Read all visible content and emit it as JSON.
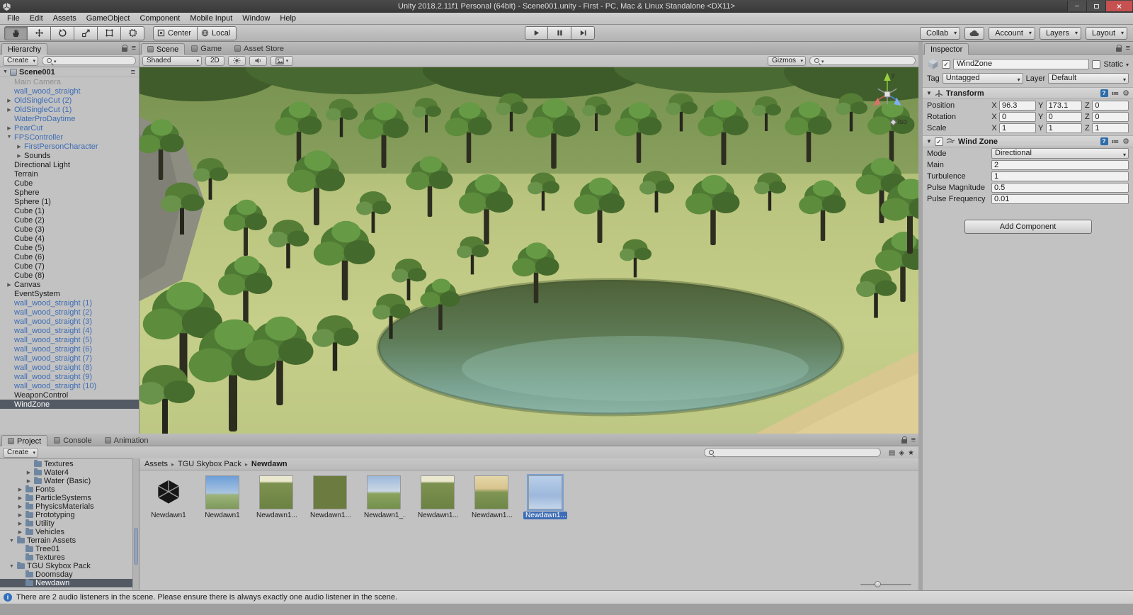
{
  "window": {
    "title": "Unity 2018.2.11f1 Personal (64bit) - Scene001.unity - First - PC, Mac & Linux Standalone <DX11>"
  },
  "menu": {
    "items": [
      "File",
      "Edit",
      "Assets",
      "GameObject",
      "Component",
      "Mobile Input",
      "Window",
      "Help"
    ]
  },
  "toolbar": {
    "pivot_label": "Center",
    "space_label": "Local",
    "collab_label": "Collab",
    "account_label": "Account",
    "layers_label": "Layers",
    "layout_label": "Layout"
  },
  "hierarchy": {
    "tab": "Hierarchy",
    "create_label": "Create",
    "scene": "Scene001",
    "items": [
      {
        "label": "Main Camera",
        "style": "muted",
        "indent": 1,
        "arrow": "none"
      },
      {
        "label": "wall_wood_straight",
        "style": "prefab",
        "indent": 1,
        "arrow": "none"
      },
      {
        "label": "OldSingleCut (2)",
        "style": "prefab",
        "indent": 1,
        "arrow": "right"
      },
      {
        "label": "OldSingleCut (1)",
        "style": "prefab",
        "indent": 1,
        "arrow": "right"
      },
      {
        "label": "WaterProDaytime",
        "style": "prefab",
        "indent": 1,
        "arrow": "none"
      },
      {
        "label": "PearCut",
        "style": "prefab",
        "indent": 1,
        "arrow": "right"
      },
      {
        "label": "FPSController",
        "style": "prefab",
        "indent": 1,
        "arrow": "down"
      },
      {
        "label": "FirstPersonCharacter",
        "style": "prefab",
        "indent": 2,
        "arrow": "right"
      },
      {
        "label": "Sounds",
        "style": "normal",
        "indent": 2,
        "arrow": "right"
      },
      {
        "label": "Directional Light",
        "style": "normal",
        "indent": 1,
        "arrow": "none"
      },
      {
        "label": "Terrain",
        "style": "normal",
        "indent": 1,
        "arrow": "none"
      },
      {
        "label": "Cube",
        "style": "normal",
        "indent": 1,
        "arrow": "none"
      },
      {
        "label": "Sphere",
        "style": "normal",
        "indent": 1,
        "arrow": "none"
      },
      {
        "label": "Sphere (1)",
        "style": "normal",
        "indent": 1,
        "arrow": "none"
      },
      {
        "label": "Cube (1)",
        "style": "normal",
        "indent": 1,
        "arrow": "none"
      },
      {
        "label": "Cube (2)",
        "style": "normal",
        "indent": 1,
        "arrow": "none"
      },
      {
        "label": "Cube (3)",
        "style": "normal",
        "indent": 1,
        "arrow": "none"
      },
      {
        "label": "Cube (4)",
        "style": "normal",
        "indent": 1,
        "arrow": "none"
      },
      {
        "label": "Cube (5)",
        "style": "normal",
        "indent": 1,
        "arrow": "none"
      },
      {
        "label": "Cube (6)",
        "style": "normal",
        "indent": 1,
        "arrow": "none"
      },
      {
        "label": "Cube (7)",
        "style": "normal",
        "indent": 1,
        "arrow": "none"
      },
      {
        "label": "Cube (8)",
        "style": "normal",
        "indent": 1,
        "arrow": "none"
      },
      {
        "label": "Canvas",
        "style": "normal",
        "indent": 1,
        "arrow": "right"
      },
      {
        "label": "EventSystem",
        "style": "normal",
        "indent": 1,
        "arrow": "none"
      },
      {
        "label": "wall_wood_straight (1)",
        "style": "prefab",
        "indent": 1,
        "arrow": "none"
      },
      {
        "label": "wall_wood_straight (2)",
        "style": "prefab",
        "indent": 1,
        "arrow": "none"
      },
      {
        "label": "wall_wood_straight (3)",
        "style": "prefab",
        "indent": 1,
        "arrow": "none"
      },
      {
        "label": "wall_wood_straight (4)",
        "style": "prefab",
        "indent": 1,
        "arrow": "none"
      },
      {
        "label": "wall_wood_straight (5)",
        "style": "prefab",
        "indent": 1,
        "arrow": "none"
      },
      {
        "label": "wall_wood_straight (6)",
        "style": "prefab",
        "indent": 1,
        "arrow": "none"
      },
      {
        "label": "wall_wood_straight (7)",
        "style": "prefab",
        "indent": 1,
        "arrow": "none"
      },
      {
        "label": "wall_wood_straight (8)",
        "style": "prefab",
        "indent": 1,
        "arrow": "none"
      },
      {
        "label": "wall_wood_straight (9)",
        "style": "prefab",
        "indent": 1,
        "arrow": "none"
      },
      {
        "label": "wall_wood_straight (10)",
        "style": "prefab",
        "indent": 1,
        "arrow": "none"
      },
      {
        "label": "WeaponControl",
        "style": "normal",
        "indent": 1,
        "arrow": "none"
      },
      {
        "label": "WindZone",
        "style": "selected",
        "indent": 1,
        "arrow": "none"
      }
    ]
  },
  "scene_view": {
    "tabs": [
      "Scene",
      "Game",
      "Asset Store"
    ],
    "shaded_label": "Shaded",
    "mode_2d_label": "2D",
    "gizmos_label": "Gizmos",
    "projection_label": "Iso",
    "gizmo_axis_label": "y"
  },
  "inspector": {
    "tab": "Inspector",
    "name": "WindZone",
    "static_label": "Static",
    "tag_label": "Tag",
    "tag_value": "Untagged",
    "layer_label": "Layer",
    "layer_value": "Default",
    "transform": {
      "title": "Transform",
      "axis_labels": [
        "X",
        "Y",
        "Z"
      ],
      "rows": [
        {
          "label": "Position",
          "x": "96.3",
          "y": "173.1",
          "z": "0"
        },
        {
          "label": "Rotation",
          "x": "0",
          "y": "0",
          "z": "0"
        },
        {
          "label": "Scale",
          "x": "1",
          "y": "1",
          "z": "1"
        }
      ]
    },
    "wind_zone": {
      "title": "Wind Zone",
      "fields": [
        {
          "label": "Mode",
          "value": "Directional",
          "type": "dropdown"
        },
        {
          "label": "Main",
          "value": "2",
          "type": "field"
        },
        {
          "label": "Turbulence",
          "value": "1",
          "type": "field"
        },
        {
          "label": "Pulse Magnitude",
          "value": "0.5",
          "type": "field"
        },
        {
          "label": "Pulse Frequency",
          "value": "0.01",
          "type": "field"
        }
      ]
    },
    "add_component_label": "Add Component"
  },
  "project": {
    "tabs": [
      "Project",
      "Console",
      "Animation"
    ],
    "create_label": "Create",
    "breadcrumb": [
      "Assets",
      "TGU Skybox Pack",
      "Newdawn"
    ],
    "tree": [
      {
        "label": "Textures",
        "indent": 3,
        "arrow": "none"
      },
      {
        "label": "Water4",
        "indent": 3,
        "arrow": "right"
      },
      {
        "label": "Water (Basic)",
        "indent": 3,
        "arrow": "right"
      },
      {
        "label": "Fonts",
        "indent": 2,
        "arrow": "right"
      },
      {
        "label": "ParticleSystems",
        "indent": 2,
        "arrow": "right"
      },
      {
        "label": "PhysicsMaterials",
        "indent": 2,
        "arrow": "right"
      },
      {
        "label": "Prototyping",
        "indent": 2,
        "arrow": "right"
      },
      {
        "label": "Utility",
        "indent": 2,
        "arrow": "right"
      },
      {
        "label": "Vehicles",
        "indent": 2,
        "arrow": "right"
      },
      {
        "label": "Terrain Assets",
        "indent": 1,
        "arrow": "down"
      },
      {
        "label": "Tree01",
        "indent": 2,
        "arrow": "none"
      },
      {
        "label": "Textures",
        "indent": 2,
        "arrow": "none"
      },
      {
        "label": "TGU Skybox Pack",
        "indent": 1,
        "arrow": "down"
      },
      {
        "label": "Doomsday",
        "indent": 2,
        "arrow": "none"
      },
      {
        "label": "Newdawn",
        "indent": 2,
        "arrow": "none",
        "selected": true
      }
    ],
    "assets": [
      {
        "label": "Newdawn1",
        "thumb": "unity-logo"
      },
      {
        "label": "Newdawn1",
        "thumb": "sky-horizon"
      },
      {
        "label": "Newdawn1...",
        "thumb": "field-top"
      },
      {
        "label": "Newdawn1...",
        "thumb": "olive"
      },
      {
        "label": "Newdawn1_...",
        "thumb": "sky-land"
      },
      {
        "label": "Newdawn1...",
        "thumb": "field-top"
      },
      {
        "label": "Newdawn1...",
        "thumb": "sunset-land"
      },
      {
        "label": "Newdawn1...",
        "thumb": "pale-blue",
        "selected": true
      }
    ]
  },
  "status_bar": {
    "message": "There are 2 audio listeners in the scene. Please ensure there is always exactly one audio listener in the scene."
  }
}
